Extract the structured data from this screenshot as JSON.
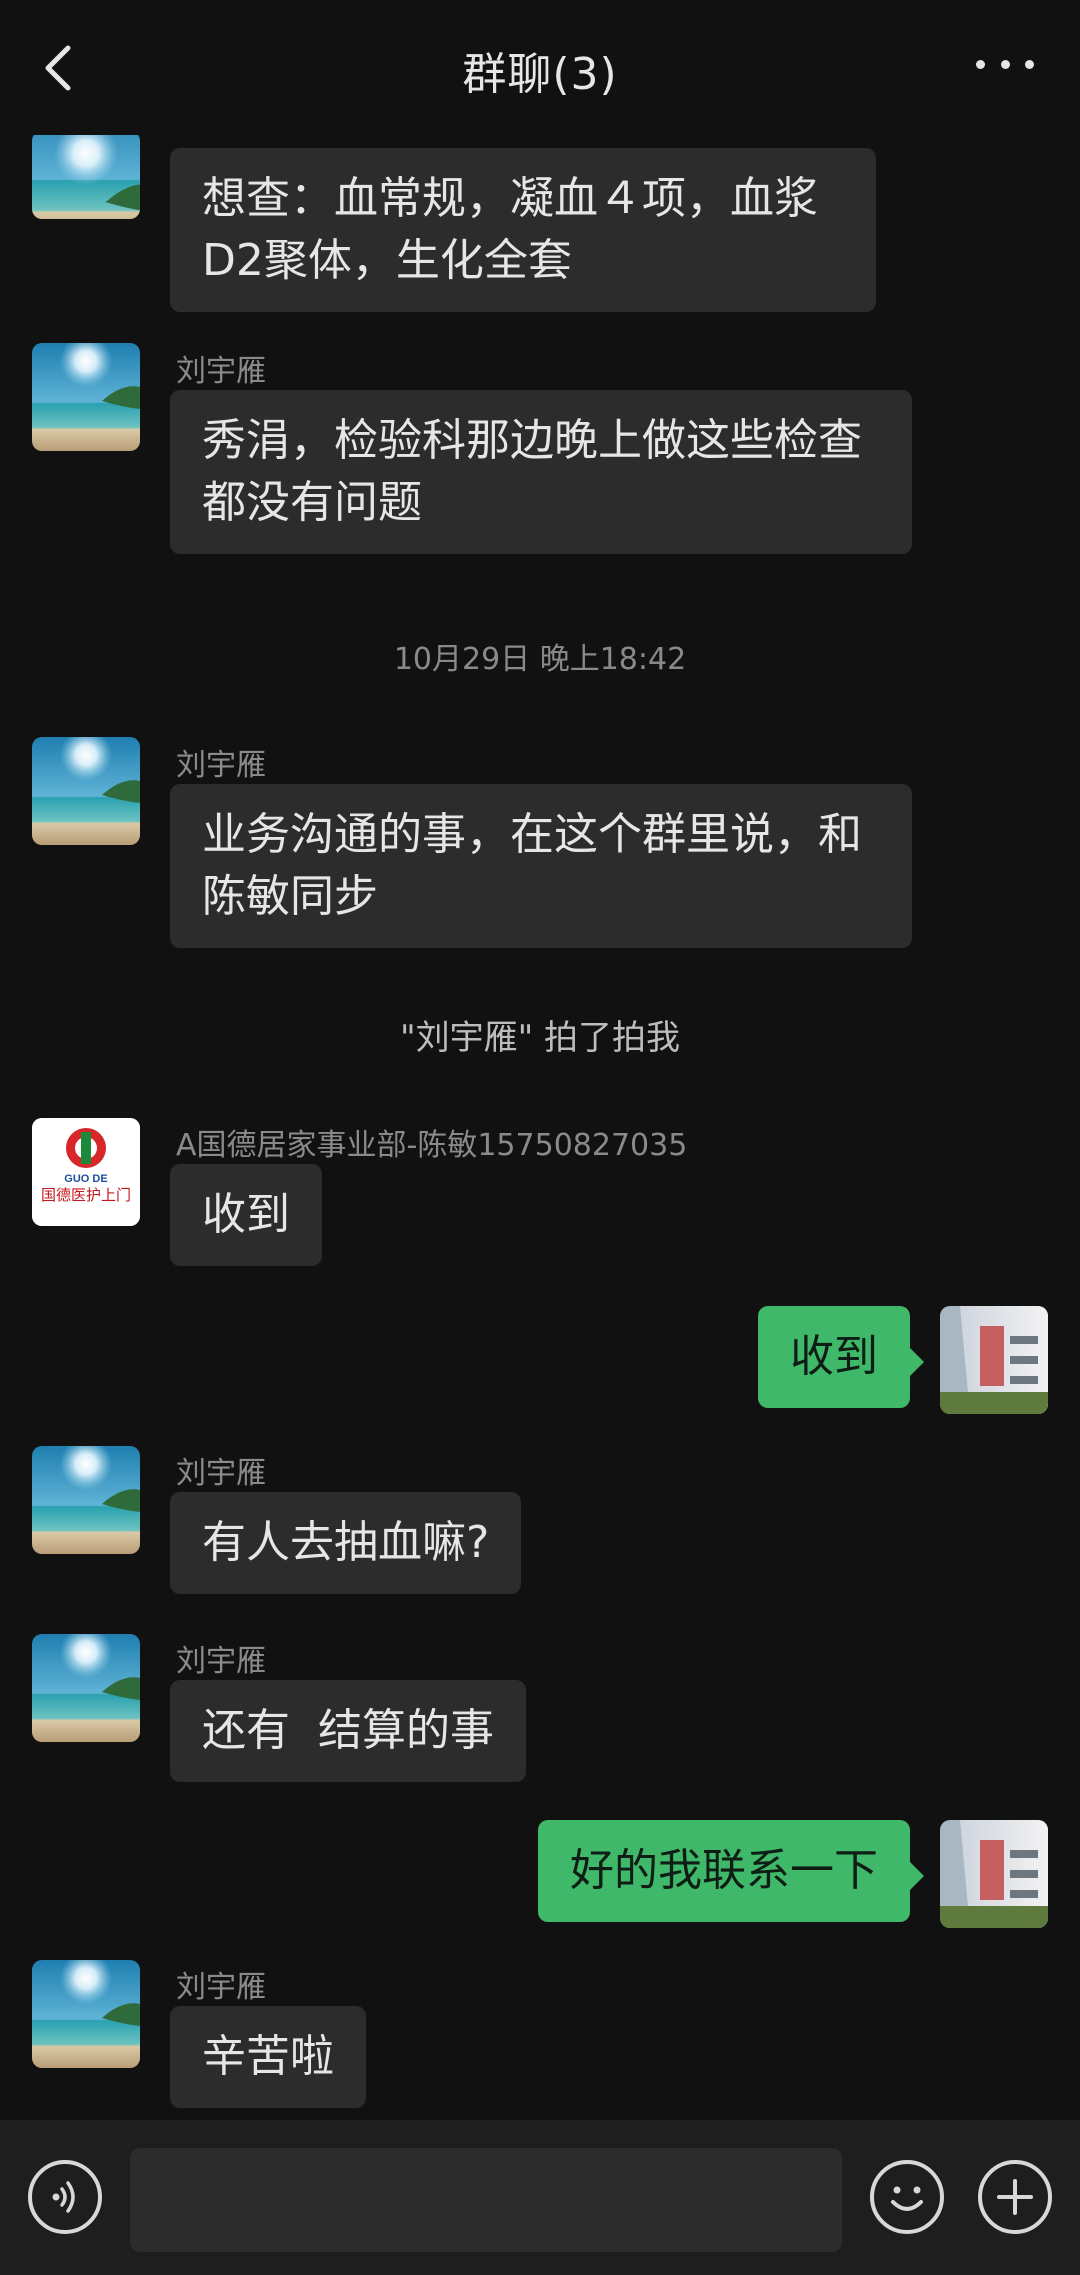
{
  "header": {
    "title": "群聊(3)"
  },
  "messages": {
    "m1": {
      "text": "想查：血常规，凝血４项，血浆D2聚体，生化全套"
    },
    "m2": {
      "sender": "刘宇雁",
      "text": "秀涓，检验科那边晚上做这些检查都没有问题"
    },
    "time1": "10月29日 晚上18:42",
    "m3": {
      "sender": "刘宇雁",
      "text": "业务沟通的事，在这个群里说，和陈敏同步"
    },
    "pat": "\"刘宇雁\" 拍了拍我",
    "m4": {
      "sender": "A国德居家事业部-陈敏15750827035",
      "text": "收到"
    },
    "m5": {
      "text": "收到"
    },
    "m6": {
      "sender": "刘宇雁",
      "text": "有人去抽血嘛?"
    },
    "m7": {
      "sender": "刘宇雁",
      "text": "还有  结算的事"
    },
    "m8": {
      "text": "好的我联系一下"
    },
    "m9": {
      "sender": "刘宇雁",
      "text": "辛苦啦"
    }
  },
  "logo": {
    "brand_top": "GUO DE",
    "brand_text": "国德医护上门"
  },
  "colors": {
    "background": "#111111",
    "incoming_bubble": "#2c2c2c",
    "outgoing_bubble": "#3fb86a",
    "input_bar": "#1e1e1e"
  },
  "icons": {
    "back": "chevron-left-icon",
    "more": "more-dots-icon",
    "voice": "voice-icon",
    "emoji": "emoji-icon",
    "plus": "plus-icon"
  }
}
